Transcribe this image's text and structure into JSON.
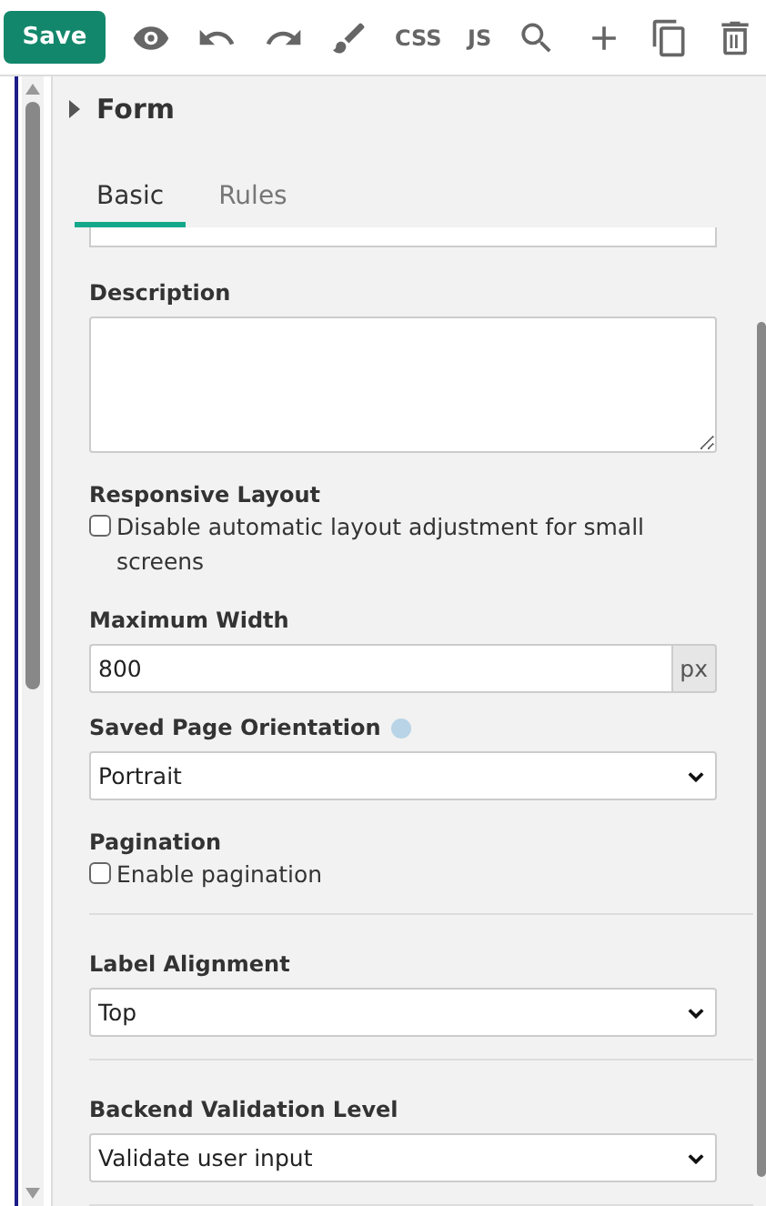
{
  "toolbar": {
    "save": "Save",
    "css": "CSS",
    "js": "JS"
  },
  "panel": {
    "title": "Form",
    "expanded": false
  },
  "tabs": [
    {
      "label": "Basic",
      "selected": true
    },
    {
      "label": "Rules",
      "selected": false
    }
  ],
  "sections": [
    {
      "fields": [
        {
          "kind": "cut"
        },
        {
          "kind": "textarea",
          "label": "Description"
        },
        {
          "kind": "checkbox",
          "label": "Responsive Layout",
          "text": "Disable automatic layout adjustment for small screens",
          "checked": false
        },
        {
          "kind": "unit",
          "label": "Maximum Width",
          "value": "800",
          "unit": "px"
        },
        {
          "kind": "select",
          "label": "Saved Page Orientation",
          "help": true,
          "value": "Portrait"
        },
        {
          "kind": "checkbox",
          "label": "Pagination",
          "text": "Enable pagination",
          "checked": false
        }
      ]
    },
    {
      "fields": [
        {
          "kind": "select",
          "label": "Label Alignment",
          "help": false,
          "value": "Top"
        }
      ]
    },
    {
      "fields": [
        {
          "kind": "select",
          "label": "Backend Validation Level",
          "help": false,
          "value": "Validate user input"
        }
      ]
    }
  ]
}
